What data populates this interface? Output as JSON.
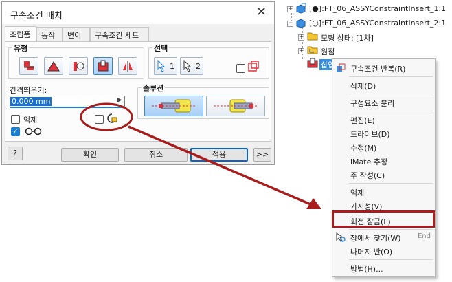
{
  "dialog": {
    "title": "구속조건 배치",
    "tabs": [
      "조립품",
      "동작",
      "변이",
      "구속조건 세트"
    ],
    "type_group_label": "유형",
    "selection_group_label": "선택",
    "selection_1": "1",
    "selection_2": "2",
    "offset_label": "간격띄우기:",
    "offset_value": "0.000 mm",
    "solution_group_label": "솔루션",
    "suppress_label": "억제",
    "ok_label": "확인",
    "cancel_label": "취소",
    "apply_label": "적용",
    "expand_label": ">>",
    "help_icon": "?"
  },
  "tree": {
    "row1": "[●]:FT_06_ASSYConstraintInsert_1:1",
    "row2": "[○]:FT_06_ASSYConstraintInsert_2:1",
    "row3": "모형 상태: [1차]",
    "row4": "원점",
    "row5": "삽입"
  },
  "context_menu": {
    "items": [
      {
        "label": "구속조건 반복(R)",
        "shortcut": ""
      },
      {
        "label": "삭제(D)",
        "shortcut": ""
      },
      {
        "label": "구성요소 분리",
        "shortcut": ""
      },
      {
        "label": "편집(E)",
        "shortcut": ""
      },
      {
        "label": "드라이브(D)",
        "shortcut": ""
      },
      {
        "label": "수정(M)",
        "shortcut": ""
      },
      {
        "label": "iMate 추정",
        "shortcut": ""
      },
      {
        "label": "주 작성(C)",
        "shortcut": ""
      },
      {
        "label": "억제",
        "shortcut": ""
      },
      {
        "label": "가시성(V)",
        "shortcut": ""
      },
      {
        "label": "회전 잠금(L)",
        "shortcut": ""
      },
      {
        "label": "창에서 찾기(W)",
        "shortcut": "End"
      },
      {
        "label": "나머지 반(O)",
        "shortcut": ""
      },
      {
        "label": "방법(H)...",
        "shortcut": ""
      }
    ]
  },
  "colors": {
    "annotation_red": "#a81c1c",
    "accent_blue": "#1a7fd6",
    "menu_background": "#f7f7f7"
  }
}
